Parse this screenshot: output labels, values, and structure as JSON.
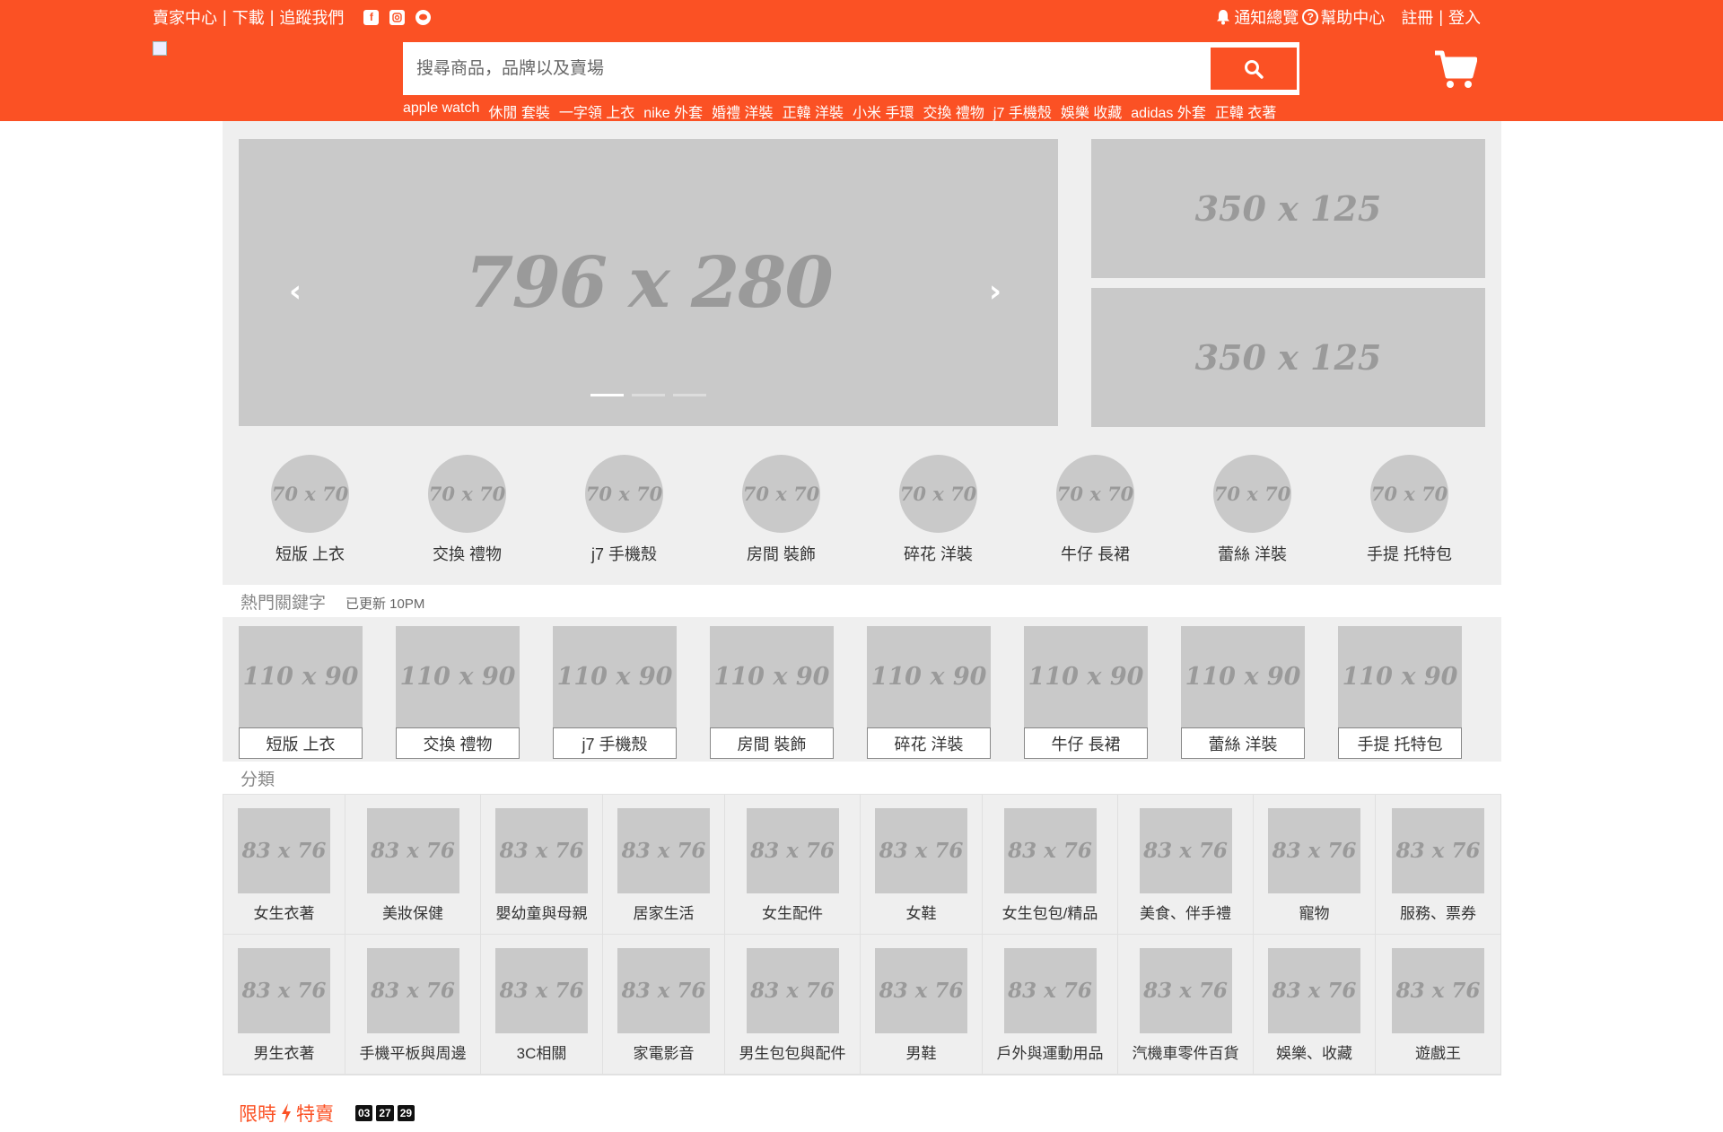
{
  "topbar": {
    "seller_center": "賣家中心",
    "download": "下載",
    "follow_us": "追蹤我們",
    "separator": "|",
    "notifications": "通知總覽",
    "help_center": "幫助中心",
    "register": "註冊",
    "login": "登入"
  },
  "header": {
    "search_placeholder": "搜尋商品，品牌以及賣場",
    "hot_words": [
      "apple watch",
      "休閒 套裝",
      "一字領 上衣",
      "nike 外套",
      "婚禮 洋裝",
      "正韓 洋裝",
      "小米 手環",
      "交換 禮物",
      "j7 手機殼",
      "娛樂 收藏",
      "adidas 外套",
      "正韓 衣著"
    ]
  },
  "hero": {
    "banner_placeholder": "796 x 280",
    "side_placeholder_1": "350 x 125",
    "side_placeholder_2": "350 x 125",
    "prev_arrow": "‹",
    "next_arrow": "›"
  },
  "circles": {
    "placeholder": "70 x 70",
    "items": [
      "短版 上衣",
      "交換 禮物",
      "j7 手機殼",
      "房間 裝飾",
      "碎花 洋裝",
      "牛仔 長裙",
      "蕾絲 洋裝",
      "手提 托特包"
    ]
  },
  "keywords": {
    "title": "熱門關鍵字",
    "updated": "已更新 10PM",
    "placeholder": "110 x 90",
    "items": [
      "短版 上衣",
      "交換 禮物",
      "j7 手機殼",
      "房間 裝飾",
      "碎花 洋裝",
      "牛仔 長裙",
      "蕾絲 洋裝",
      "手提 托特包"
    ]
  },
  "categories": {
    "title": "分類",
    "placeholder": "83 x 76",
    "items": [
      "女生衣著",
      "美妝保健",
      "嬰幼童與母親",
      "居家生活",
      "女生配件",
      "女鞋",
      "女生包包/精品",
      "美食、伴手禮",
      "寵物",
      "服務、票券",
      "男生衣著",
      "手機平板與周邊",
      "3C相關",
      "家電影音",
      "男生包包與配件",
      "男鞋",
      "戶外與運動用品",
      "汽機車零件百貨",
      "娛樂、收藏",
      "遊戲王"
    ]
  },
  "flash_sale": {
    "label_1": "限時",
    "label_2": "特賣",
    "hours": "03",
    "minutes": "27",
    "seconds": "29"
  },
  "colors": {
    "brand": "#fb5124",
    "placeholder_bg": "#c9c9c9",
    "panel_bg": "#efefef"
  }
}
